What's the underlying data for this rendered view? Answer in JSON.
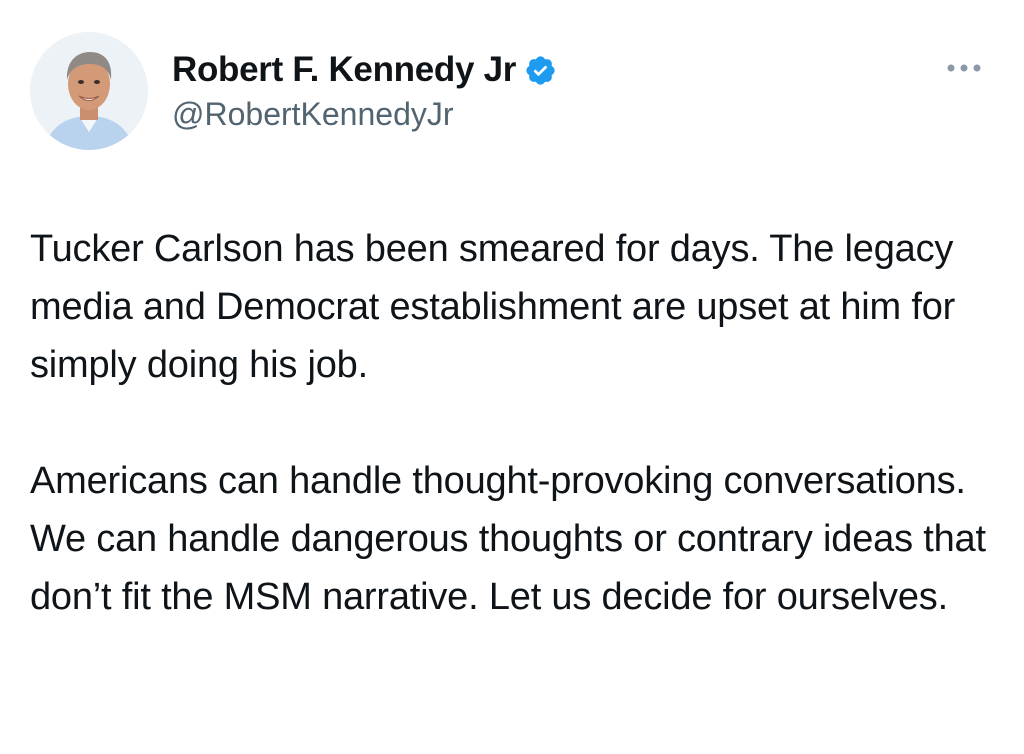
{
  "tweet": {
    "author": {
      "display_name": "Robert F. Kennedy Jr",
      "handle": "@RobertKennedyJr",
      "verified_icon": "verified-badge-icon",
      "avatar_icon": "profile-photo"
    },
    "more_icon": "more-options-icon",
    "paragraphs": [
      "Tucker Carlson has been smeared for days. The legacy media and Democrat establishment are upset at him for simply doing his job.",
      "Americans can handle thought-provoking conversations. We can handle dangerous thoughts or contrary ideas that don’t fit the MSM narrative. Let us decide for ourselves."
    ]
  },
  "colors": {
    "text_primary": "#0f1419",
    "text_secondary": "#536471",
    "verified_blue": "#1d9bf0",
    "background": "#ffffff"
  }
}
